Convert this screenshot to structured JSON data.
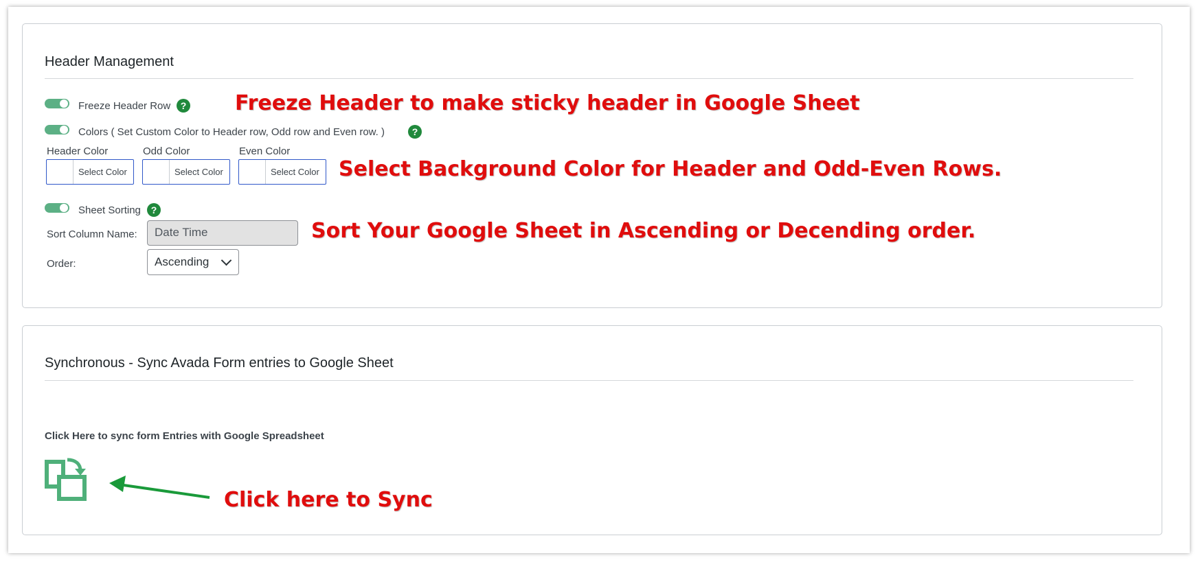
{
  "header_panel": {
    "title": "Header Management",
    "freeze": {
      "label": "Freeze Header Row",
      "help": "?",
      "enabled": true
    },
    "colors": {
      "label": "Colors ( Set Custom Color to Header row, Odd row and Even row. )",
      "help": "?",
      "enabled": true,
      "pickers": [
        {
          "label": "Header Color",
          "button": "Select Color"
        },
        {
          "label": "Odd Color",
          "button": "Select Color"
        },
        {
          "label": "Even Color",
          "button": "Select Color"
        }
      ]
    },
    "sorting": {
      "label": "Sheet Sorting",
      "help": "?",
      "enabled": true,
      "column_label": "Sort Column Name:",
      "column_value": "Date Time",
      "order_label": "Order:",
      "order_value": "Ascending"
    }
  },
  "sync_panel": {
    "title": "Synchronous - Sync Avada Form entries to Google Sheet",
    "caption": "Click Here to sync form Entries with Google Spreadsheet",
    "icon": "sync-icon"
  },
  "annotations": {
    "freeze": "Freeze Header to make sticky header in Google Sheet",
    "colors": "Select Background Color for Header and Odd-Even Rows.",
    "sorting": "Sort Your Google Sheet in Ascending or Decending order.",
    "sync": "Click here to Sync"
  },
  "colors": {
    "toggle_on": "#5cb085",
    "help_green": "#20893c",
    "annotation_red": "#e00d0d",
    "sync_icon": "#4fb07a",
    "arrow_green": "#1a9a3a"
  }
}
